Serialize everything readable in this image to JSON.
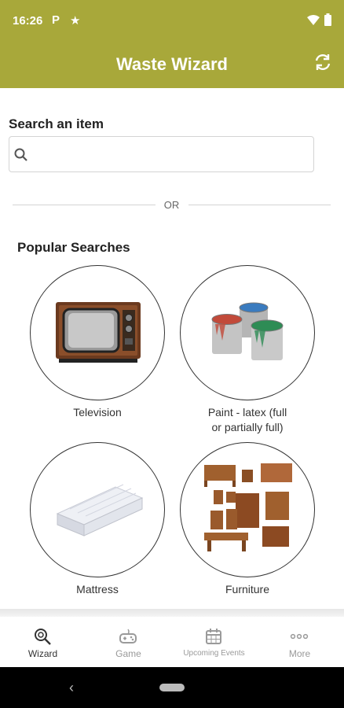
{
  "status_bar": {
    "time": "16:26",
    "icons": [
      "p-icon",
      "star-icon",
      "wifi-icon",
      "battery-icon"
    ]
  },
  "app_bar": {
    "title": "Waste Wizard",
    "action_icon": "refresh-icon"
  },
  "search": {
    "label": "Search an item",
    "placeholder": "",
    "value": ""
  },
  "divider": {
    "text": "OR"
  },
  "popular": {
    "title": "Popular Searches",
    "items": [
      {
        "label": "Television"
      },
      {
        "label": "Paint - latex (full",
        "label2": "or partially full)"
      },
      {
        "label": "Mattress"
      },
      {
        "label": "Furniture"
      }
    ]
  },
  "tabs": [
    {
      "label": "Wizard",
      "icon": "search-gear-icon",
      "active": true
    },
    {
      "label": "Game",
      "icon": "gamepad-icon",
      "active": false
    },
    {
      "label": "Upcoming Events",
      "icon": "calendar-icon",
      "active": false
    },
    {
      "label": "More",
      "icon": "more-icon",
      "active": false
    }
  ],
  "colors": {
    "brand": "#a8a83a",
    "active_tab": "#333333",
    "inactive_tab": "#9a9a9a"
  }
}
